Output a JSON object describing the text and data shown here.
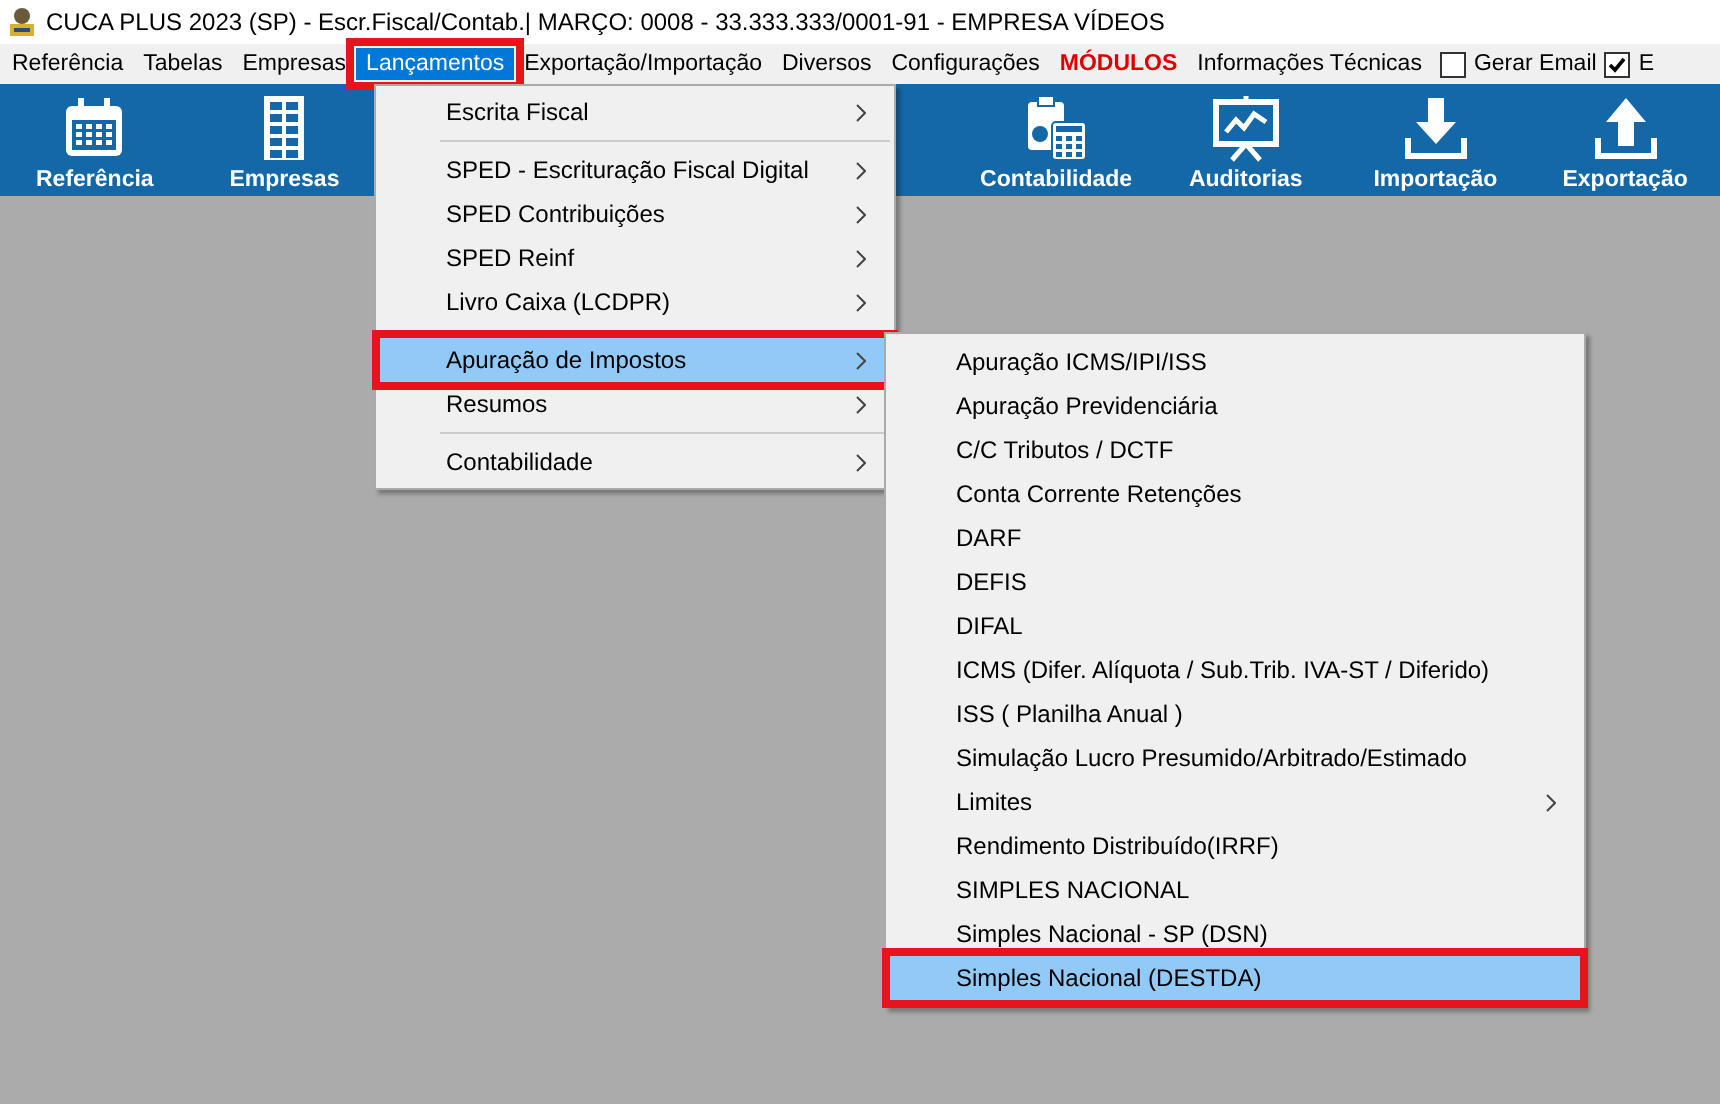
{
  "window": {
    "title": "CUCA PLUS 2023 (SP) - Escr.Fiscal/Contab.| MARÇO: 0008 - 33.333.333/0001-91 - EMPRESA VÍDEOS"
  },
  "menu_bar": [
    {
      "label": "Referência",
      "kind": "menu",
      "selected": false,
      "highlighted": false
    },
    {
      "label": "Tabelas",
      "kind": "menu",
      "selected": false,
      "highlighted": false
    },
    {
      "label": "Empresas",
      "kind": "menu",
      "selected": false,
      "highlighted": false
    },
    {
      "label": "Lançamentos",
      "kind": "menu",
      "selected": true,
      "highlighted": true
    },
    {
      "label": "Exportação/Importação",
      "kind": "menu",
      "selected": false,
      "highlighted": false
    },
    {
      "label": "Diversos",
      "kind": "menu",
      "selected": false,
      "highlighted": false
    },
    {
      "label": "Configurações",
      "kind": "menu",
      "selected": false,
      "highlighted": false
    },
    {
      "label": "MÓDULOS",
      "kind": "accent",
      "selected": false,
      "highlighted": false
    },
    {
      "label": "Informações Técnicas",
      "kind": "menu",
      "selected": false,
      "highlighted": false
    },
    {
      "label": "Gerar Email",
      "kind": "checkbox",
      "checked": false
    },
    {
      "label": "E",
      "kind": "checkbox",
      "checked": true
    }
  ],
  "toolbar": [
    {
      "label": "Referência"
    },
    {
      "label": "Empresas"
    },
    {
      "label": "Contabilidade"
    },
    {
      "label": "Auditorias"
    },
    {
      "label": "Importação"
    },
    {
      "label": "Exportação"
    }
  ],
  "dropdown": [
    {
      "label": "Escrita Fiscal",
      "submenu": true,
      "selected": false,
      "highlighted": false,
      "separator_after": true
    },
    {
      "label": "SPED - Escrituração Fiscal Digital",
      "submenu": true,
      "selected": false,
      "highlighted": false,
      "separator_after": false
    },
    {
      "label": "SPED Contribuições",
      "submenu": true,
      "selected": false,
      "highlighted": false,
      "separator_after": false
    },
    {
      "label": "SPED Reinf",
      "submenu": true,
      "selected": false,
      "highlighted": false,
      "separator_after": false
    },
    {
      "label": "Livro Caixa (LCDPR)",
      "submenu": true,
      "selected": false,
      "highlighted": false,
      "separator_after": true
    },
    {
      "label": "Apuração de Impostos",
      "submenu": true,
      "selected": true,
      "highlighted": true,
      "separator_after": false
    },
    {
      "label": "Resumos",
      "submenu": true,
      "selected": false,
      "highlighted": false,
      "separator_after": true
    },
    {
      "label": "Contabilidade",
      "submenu": true,
      "selected": false,
      "highlighted": false,
      "separator_after": false
    }
  ],
  "submenu": [
    {
      "label": "Apuração ICMS/IPI/ISS",
      "submenu": false,
      "selected": false,
      "highlighted": false
    },
    {
      "label": "Apuração Previdenciária",
      "submenu": false,
      "selected": false,
      "highlighted": false
    },
    {
      "label": "C/C Tributos / DCTF",
      "submenu": false,
      "selected": false,
      "highlighted": false
    },
    {
      "label": "Conta Corrente Retenções",
      "submenu": false,
      "selected": false,
      "highlighted": false
    },
    {
      "label": "DARF",
      "submenu": false,
      "selected": false,
      "highlighted": false
    },
    {
      "label": "DEFIS",
      "submenu": false,
      "selected": false,
      "highlighted": false
    },
    {
      "label": "DIFAL",
      "submenu": false,
      "selected": false,
      "highlighted": false
    },
    {
      "label": "ICMS (Difer. Alíquota / Sub.Trib. IVA-ST / Diferido)",
      "submenu": false,
      "selected": false,
      "highlighted": false
    },
    {
      "label": "ISS ( Planilha Anual )",
      "submenu": false,
      "selected": false,
      "highlighted": false
    },
    {
      "label": "Simulação Lucro Presumido/Arbitrado/Estimado",
      "submenu": false,
      "selected": false,
      "highlighted": false
    },
    {
      "label": "Limites",
      "submenu": true,
      "selected": false,
      "highlighted": false
    },
    {
      "label": "Rendimento Distribuído(IRRF)",
      "submenu": false,
      "selected": false,
      "highlighted": false
    },
    {
      "label": "SIMPLES NACIONAL",
      "submenu": false,
      "selected": false,
      "highlighted": false
    },
    {
      "label": "Simples Nacional - SP (DSN)",
      "submenu": false,
      "selected": false,
      "highlighted": false
    },
    {
      "label": "Simples Nacional  (DESTDA)",
      "submenu": false,
      "selected": true,
      "highlighted": true
    }
  ]
}
